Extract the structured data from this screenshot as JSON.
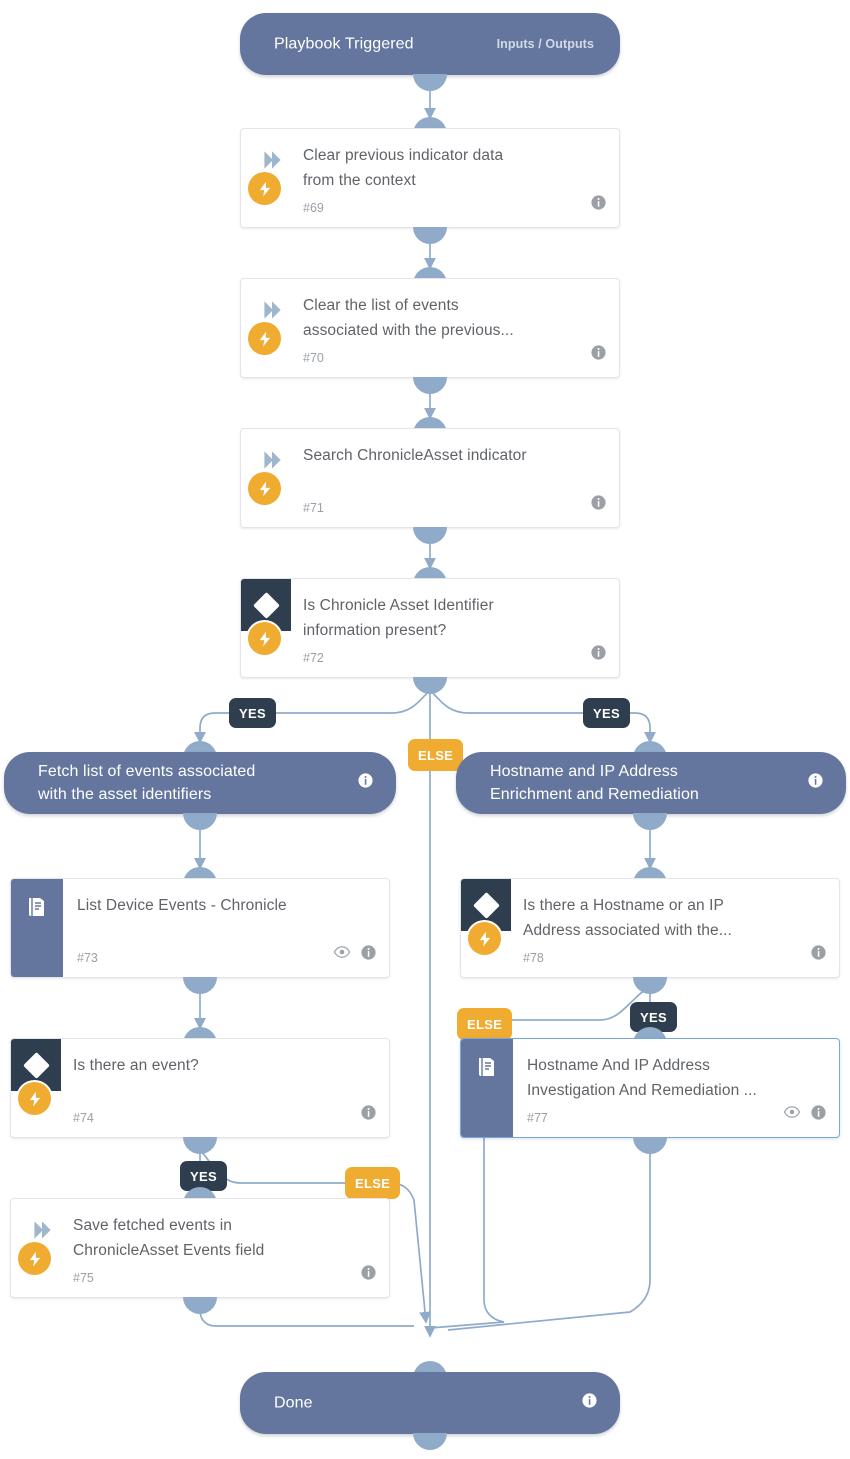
{
  "diagram": {
    "title": "Playbook workflow",
    "colors": {
      "node_bg": "#ffffff",
      "pill_bg": "#64769e",
      "condition_icon_bg": "#2e3e4e",
      "bolt_badge": "#f0ab31",
      "edge": "#8fabc9",
      "yes_label_bg": "#2e3e4e",
      "else_label_bg": "#f0ab31",
      "selected_border": "#7aa8d8"
    }
  },
  "start": {
    "label": "Playbook Triggered",
    "inputs_outputs": "Inputs / Outputs"
  },
  "end": {
    "label": "Done"
  },
  "nodes": [
    {
      "id": "#69",
      "title": "Clear previous indicator data\nfrom the context",
      "kind": "action",
      "icons": [
        "info-icon"
      ]
    },
    {
      "id": "#70",
      "title": "Clear the list of events\nassociated with the previous...",
      "kind": "action",
      "icons": [
        "info-icon"
      ]
    },
    {
      "id": "#71",
      "title": "Search ChronicleAsset indicator",
      "kind": "action",
      "icons": [
        "info-icon"
      ]
    },
    {
      "id": "#72",
      "title": "Is Chronicle Asset Identifier\ninformation present?",
      "kind": "condition",
      "icons": [
        "info-icon"
      ]
    },
    {
      "id": "#73",
      "title": "List Device Events - Chronicle",
      "kind": "subplaybook",
      "icons": [
        "eye-icon",
        "info-icon"
      ]
    },
    {
      "id": "#74",
      "title": "Is there an event?",
      "kind": "condition",
      "icons": [
        "info-icon"
      ]
    },
    {
      "id": "#75",
      "title": "Save fetched events in\nChronicleAsset Events field",
      "kind": "action",
      "icons": [
        "info-icon"
      ]
    },
    {
      "id": "#78",
      "title": "Is there a Hostname or an IP\nAddress associated with the...",
      "kind": "condition",
      "icons": [
        "info-icon"
      ]
    },
    {
      "id": "#77",
      "title": "Hostname And IP Address\nInvestigation And Remediation ...",
      "kind": "subplaybook",
      "selected": true,
      "icons": [
        "eye-icon",
        "info-icon"
      ]
    }
  ],
  "group_nodes": [
    {
      "key": "fetch_events",
      "label": "Fetch list of events associated\nwith the asset identifiers"
    },
    {
      "key": "hostname_ip",
      "label": "Hostname and IP Address\nEnrichment and Remediation"
    }
  ],
  "branch_labels": {
    "yes_left_72": "YES",
    "yes_right_72": "YES",
    "else_72": "ELSE",
    "else_78": "ELSE",
    "yes_78": "YES",
    "yes_74": "YES",
    "else_74": "ELSE"
  }
}
